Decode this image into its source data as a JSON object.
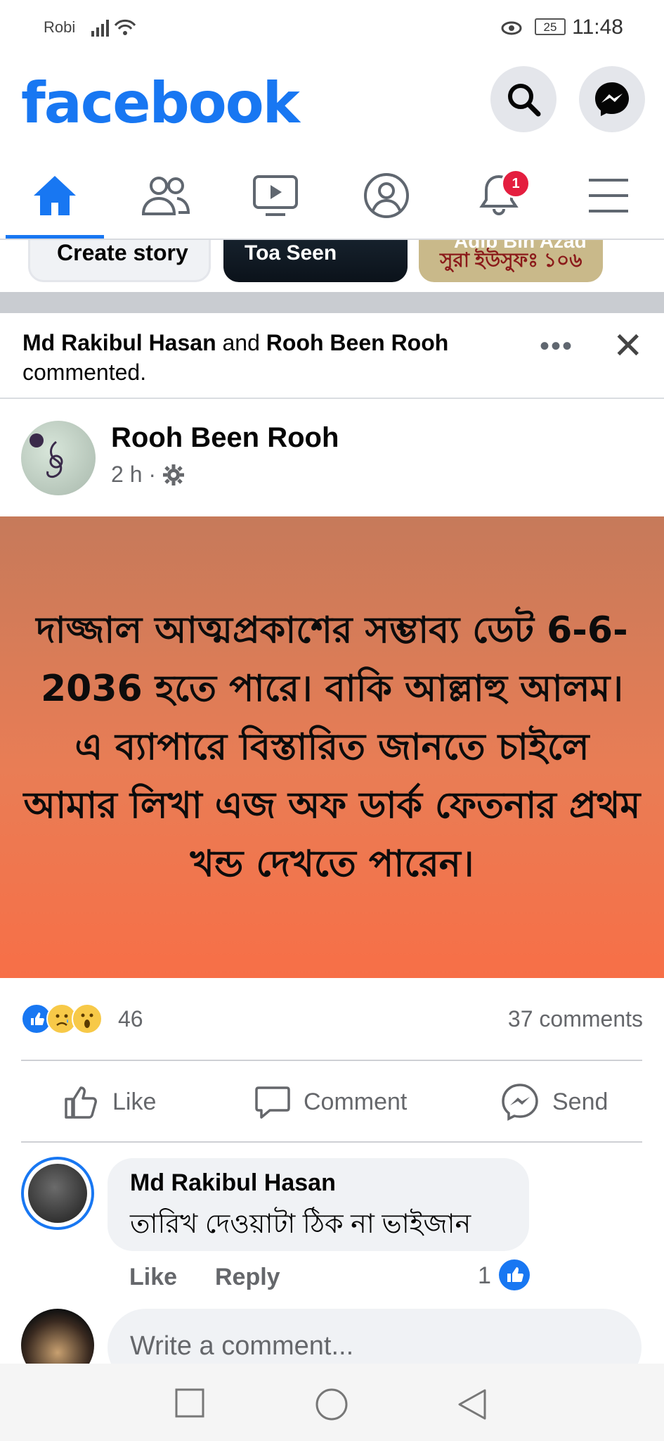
{
  "status_bar": {
    "carrier": "Robi",
    "battery": "25",
    "time": "11:48"
  },
  "header": {
    "logo": "facebook",
    "icons": [
      "search-icon",
      "messenger-icon"
    ]
  },
  "nav": {
    "tabs": [
      "home-icon",
      "friends-icon",
      "watch-icon",
      "profile-icon",
      "notifications-icon",
      "menu-icon"
    ],
    "active": "home",
    "notification_badge": "1"
  },
  "stories": {
    "create": "Create story",
    "story2": "Toa Seen",
    "story3_top": "Adib Bin Azad",
    "story3_bottom": "সুরা ইউসুফঃ ১০৬"
  },
  "post": {
    "activity_user1": "Md Rakibul Hasan",
    "activity_and": "and",
    "activity_user2": "Rooh Been Rooh",
    "activity_suffix": "commented.",
    "more": "•••",
    "close": "✕",
    "author": "Rooh Been Rooh",
    "time": "2 h ·",
    "text": "দাজ্জাল আত্মপ্রকাশের সম্ভাব্য ডেট 6-6-2036 হতে পারে। বাকি আল্লাহু আলম। এ ব্যাপারে বিস্তারিত জানতে চাইলে আমার লিখা এজ অফ ডার্ক ফেতনার প্রথম খন্ড দেখতে পারেন।",
    "image_colors": {
      "top": "#c67a5a",
      "bottom": "#f76f47"
    },
    "reaction_count": "46",
    "comment_count": "37 comments",
    "actions": {
      "like": "Like",
      "comment": "Comment",
      "send": "Send"
    }
  },
  "comment": {
    "name": "Md Rakibul Hasan",
    "text": "তারিখ দেওয়াটা ঠিক না ভাইজান",
    "like": "Like",
    "reply": "Reply",
    "like_count": "1"
  },
  "composer": {
    "placeholder": "Write a comment..."
  },
  "colors": {
    "brand": "#1877f2",
    "badge": "#e41e3f"
  }
}
